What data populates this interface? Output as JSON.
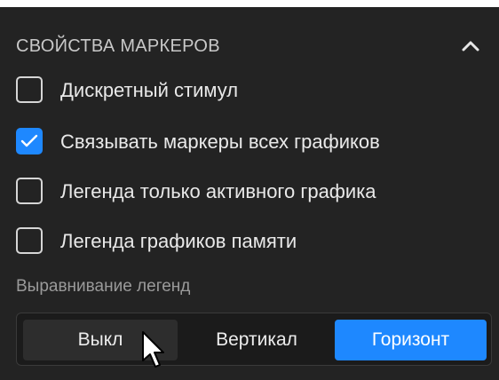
{
  "panel": {
    "title": "СВОЙСТВА МАРКЕРОВ",
    "collapse_icon": "chevron-up-icon",
    "accent_color": "#1e88ff",
    "background_color": "#232323"
  },
  "options": [
    {
      "label": "Дискретный стимул",
      "checked": false
    },
    {
      "label": "Связывать маркеры всех графиков",
      "checked": true
    },
    {
      "label": "Легенда только активного графика",
      "checked": false
    },
    {
      "label": "Легенда графиков памяти",
      "checked": false
    }
  ],
  "legend_alignment": {
    "label": "Выравнивание легенд",
    "options": [
      "Выкл",
      "Вертикал",
      "Горизонт"
    ],
    "selected": "Горизонт",
    "hovered": "Выкл"
  },
  "cursor_icon": "mouse-pointer-icon"
}
